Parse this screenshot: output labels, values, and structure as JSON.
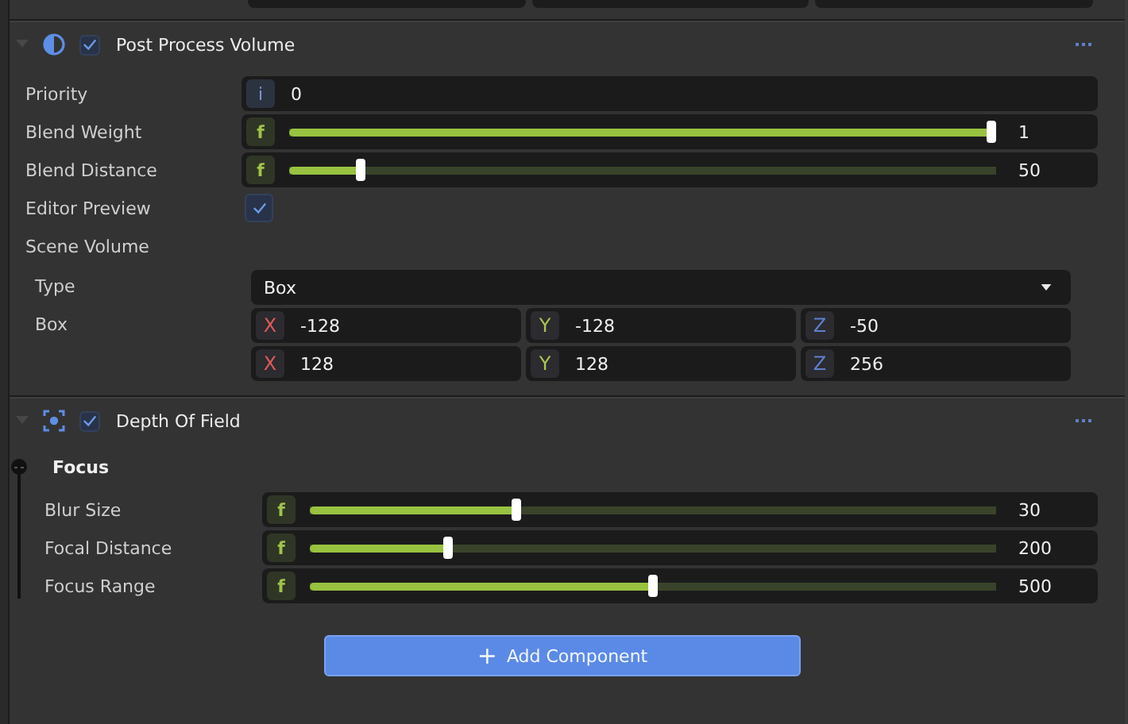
{
  "components": [
    {
      "kind": "post_process",
      "title": "Post Process Volume",
      "expanded": true,
      "enabled": true,
      "properties": [
        {
          "kind": "number",
          "label": "Priority",
          "badge": "i",
          "value": "0"
        },
        {
          "kind": "slider",
          "label": "Blend Weight",
          "badge": "f",
          "level": 1,
          "value": "1"
        },
        {
          "kind": "slider",
          "label": "Blend Distance",
          "badge": "f",
          "level": 0.095,
          "value": "50"
        },
        {
          "kind": "checkbox",
          "label": "Editor Preview",
          "checked": true
        }
      ],
      "section": {
        "title": "Scene Volume",
        "properties": [
          {
            "kind": "dropdown",
            "label": "Type",
            "value": "Box"
          },
          {
            "kind": "vector",
            "label": "Box",
            "rows": [
              [
                {
                  "axis": "X",
                  "color": "#e05a5a",
                  "value": "-128"
                },
                {
                  "axis": "Y",
                  "color": "#a8c64c",
                  "value": "-128"
                },
                {
                  "axis": "Z",
                  "color": "#5f7fd0",
                  "value": "-50"
                }
              ],
              [
                {
                  "axis": "X",
                  "color": "#e05a5a",
                  "value": "128"
                },
                {
                  "axis": "Y",
                  "color": "#a8c64c",
                  "value": "128"
                },
                {
                  "axis": "Z",
                  "color": "#5f7fd0",
                  "value": "256"
                }
              ]
            ]
          }
        ]
      }
    },
    {
      "kind": "depth_of_field",
      "title": "Depth Of Field",
      "expanded": true,
      "enabled": true,
      "group": {
        "title": "Focus",
        "expanded": true,
        "properties": [
          {
            "kind": "slider",
            "label": "Blur Size",
            "badge": "f",
            "level": 0.297,
            "value": "30"
          },
          {
            "kind": "slider",
            "label": "Focal Distance",
            "badge": "f",
            "level": 0.197,
            "value": "200"
          },
          {
            "kind": "slider",
            "label": "Focus Range",
            "badge": "f",
            "level": 0.5,
            "value": "500"
          }
        ]
      }
    }
  ],
  "add_button": {
    "icon": "+",
    "label": "Add Component"
  }
}
